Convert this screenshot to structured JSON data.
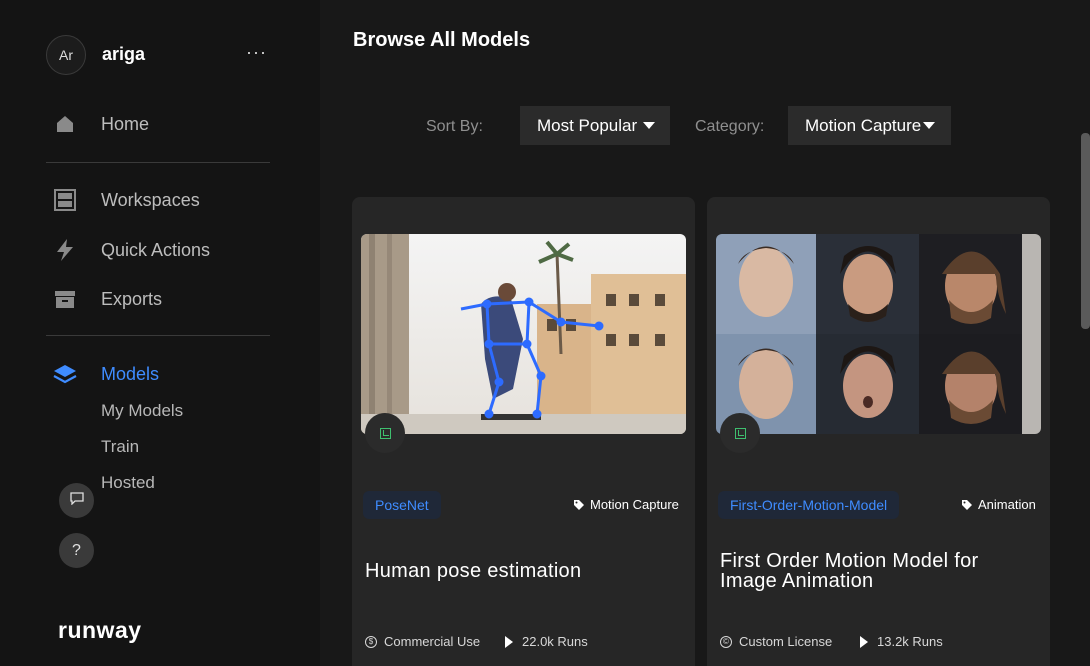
{
  "user": {
    "initials": "Ar",
    "name": "ariga",
    "more": "···"
  },
  "nav": {
    "home": "Home",
    "workspaces": "Workspaces",
    "quick_actions": "Quick Actions",
    "exports": "Exports",
    "models": "Models",
    "sub": [
      "My Models",
      "Train",
      "Hosted"
    ]
  },
  "help_button": "?",
  "brand": "runway",
  "main": {
    "title": "Browse All Models",
    "sort_label": "Sort By:",
    "sort_value": "Most Popular",
    "category_label": "Category:",
    "category_value": "Motion Capture"
  },
  "cards": [
    {
      "model": "PoseNet",
      "category": "Motion Capture",
      "title": "Human pose estimation",
      "license": "Commercial Use",
      "runs": "22.0k Runs"
    },
    {
      "model": "First-Order-Motion-Model",
      "category": "Animation",
      "title_line1": "First Order Motion Model for",
      "title_line2": "Image Animation",
      "license": "Custom License",
      "runs": "13.2k Runs"
    }
  ],
  "colors": {
    "accent": "#3f8cff",
    "sidebar_bg": "#141414",
    "card_bg": "#262626"
  },
  "icons": [
    "home-icon",
    "workspaces-icon",
    "lightning-icon",
    "archive-icon",
    "layers-icon",
    "chat-icon",
    "help-icon",
    "tag-icon",
    "dollar-icon",
    "license-icon",
    "play-icon"
  ]
}
